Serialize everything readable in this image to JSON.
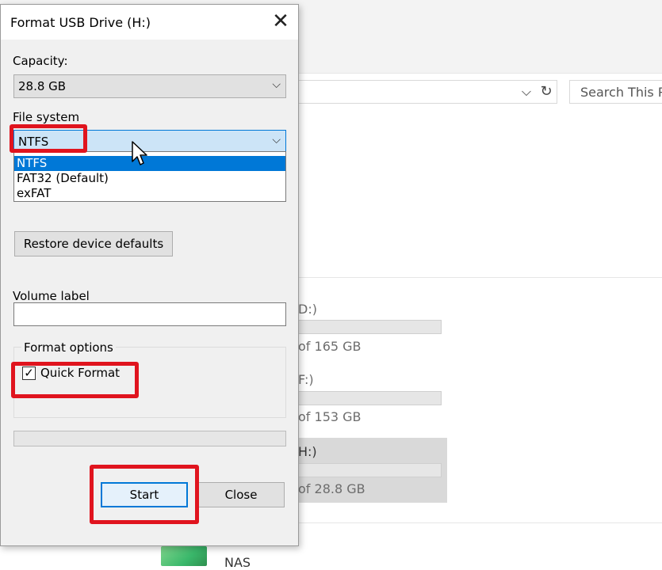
{
  "dialog": {
    "title": "Format USB Drive (H:)",
    "close_glyph": "✕",
    "capacity_label": "Capacity:",
    "capacity_value": "28.8 GB",
    "file_system_label": "File system",
    "file_system_value": "NTFS",
    "file_system_options": [
      "NTFS",
      "FAT32 (Default)",
      "exFAT"
    ],
    "restore_button": "Restore device defaults",
    "volume_label_label": "Volume label",
    "volume_label_value": "",
    "format_options_label": "Format options",
    "quick_format_label": "Quick Format",
    "quick_format_checked": true,
    "start_button": "Start",
    "close_button": "Close"
  },
  "explorer": {
    "search_placeholder": "Search This P",
    "drives": [
      {
        "label_fragment": "D:)",
        "capacity_fragment": "of 165 GB"
      },
      {
        "label_fragment": "F:)",
        "capacity_fragment": "of 153 GB"
      },
      {
        "label_fragment": "H:)",
        "capacity_fragment": "of 28.8 GB"
      }
    ],
    "network_item_label": "NAS"
  },
  "highlight_color": "#e0141e",
  "accent_color": "#0078d7"
}
